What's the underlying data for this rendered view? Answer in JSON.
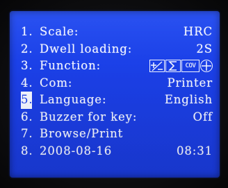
{
  "menu": {
    "items": [
      {
        "num": "1.",
        "label": "Scale:",
        "value": "HRC"
      },
      {
        "num": "2.",
        "label": "Dwell loading:",
        "value": "2S"
      },
      {
        "num": "3.",
        "label": "Function:",
        "icons": [
          "plus-minus-icon",
          "sigma-icon",
          "cov-icon",
          "phi-icon"
        ],
        "cov_text": "COV"
      },
      {
        "num": "4.",
        "label": "Com:",
        "value": "Printer"
      },
      {
        "num": "5.",
        "label": "Language:",
        "value": "English",
        "selected": true
      },
      {
        "num": "6.",
        "label": "Buzzer for key:",
        "value": "Off"
      },
      {
        "num": "7.",
        "label": "Browse/Print",
        "value": ""
      },
      {
        "num": "8.",
        "label": "2008-08-16",
        "value": "08:31"
      }
    ]
  },
  "colors": {
    "screen": "#1b3fe6",
    "text": "#f4f6ff",
    "bezel": "#121214"
  }
}
